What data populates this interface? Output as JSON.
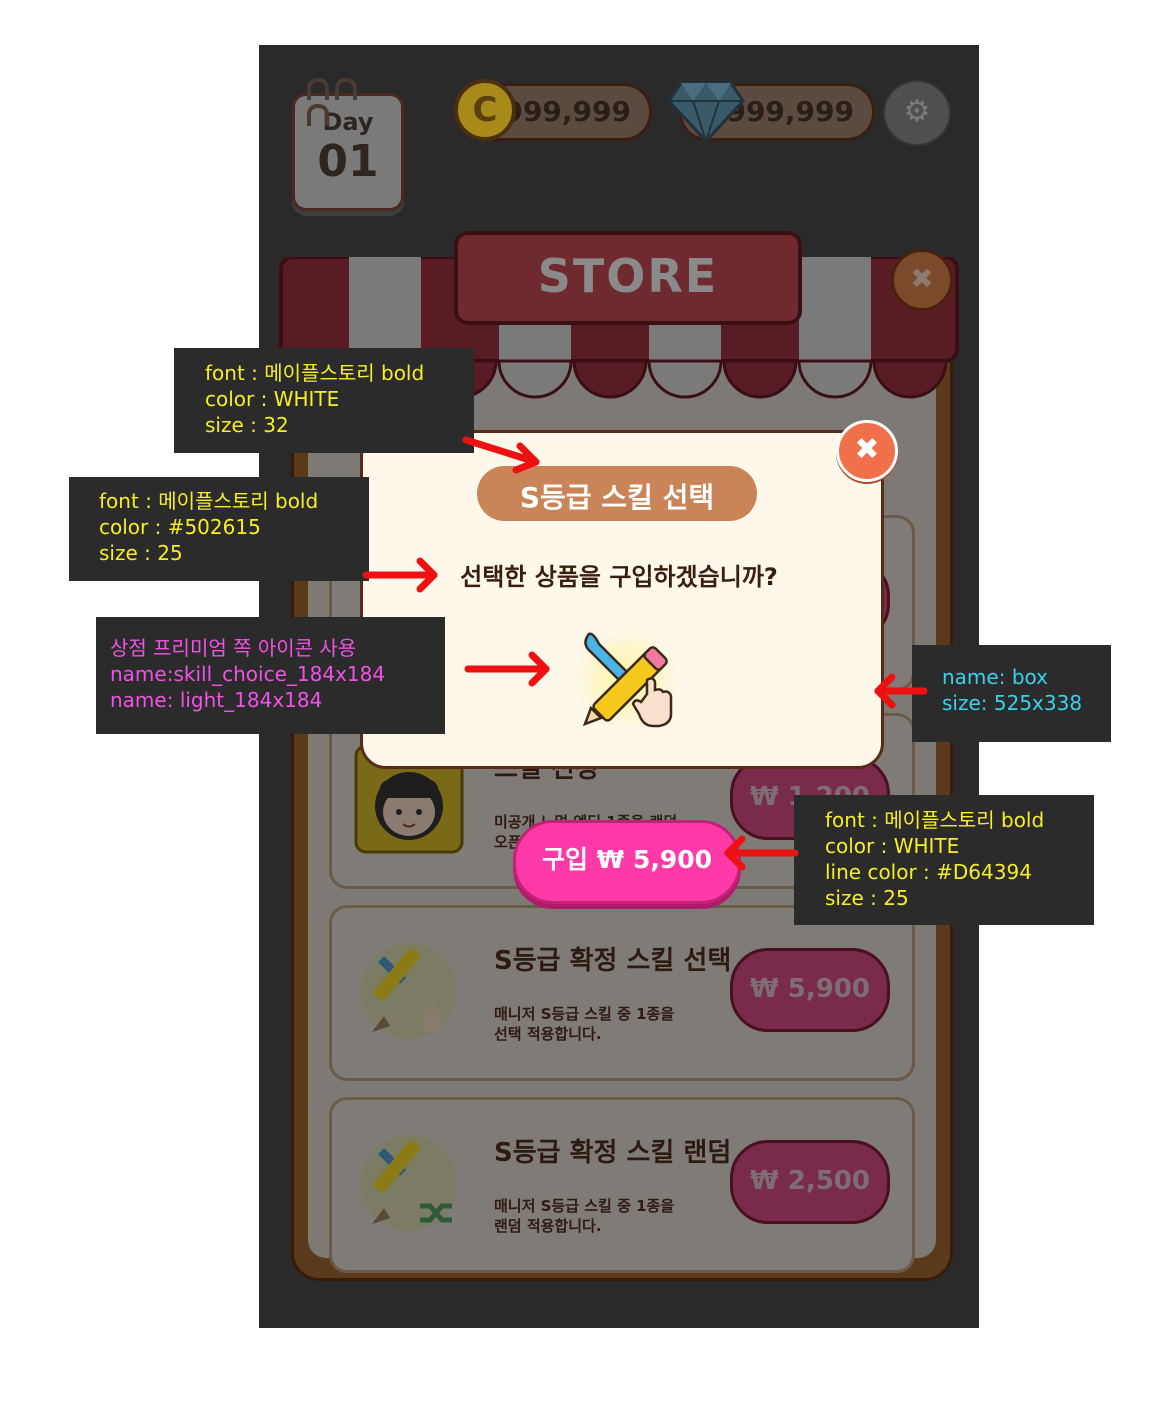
{
  "topbar": {
    "day_label": "Day",
    "day_number": "01",
    "coins": "999,999",
    "coin_symbol": "C",
    "gems": "999,999",
    "settings_icon": "gear-icon"
  },
  "store": {
    "title": "STORE",
    "close_icon": "close-icon",
    "items": [
      {
        "title": "",
        "desc_lines": [
          "",
          ""
        ],
        "price": ""
      },
      {
        "title": "스킬 선정",
        "desc_lines": [
          "미공개 노멀 엔딩 1종을 랜덤",
          "오픈"
        ],
        "price": "₩ 1,200"
      },
      {
        "title": "S등급 확정 스킬 선택",
        "desc_lines": [
          "매니저 S등급 스킬 중 1종을",
          "선택 적용합니다."
        ],
        "price": "₩ 5,900"
      },
      {
        "title": "S등급 확정 스킬 랜덤",
        "desc_lines": [
          "매니저 S등급 스킬 중 1종을",
          "랜덤 적용합니다."
        ],
        "price": "₩ 2,500"
      }
    ]
  },
  "popup": {
    "title": "S등급 스킬 선택",
    "question": "선택한 상품을 구입하겠습니까?",
    "close_icon": "close-icon",
    "icon": "skill-choice-icon",
    "buy_label": "구입  ₩ 5,900"
  },
  "annotations": {
    "title_spec": [
      "font : 메이플스토리 bold",
      "color : WHITE",
      "size : 32"
    ],
    "question_spec": [
      "font : 메이플스토리 bold",
      "color : #502615",
      "size : 25"
    ],
    "icon_spec": [
      "상점 프리미엄 쪽 아이콘 사용",
      "name:skill_choice_184x184",
      "name: light_184x184"
    ],
    "box_spec": [
      "name: box",
      "size: 525x338"
    ],
    "button_spec": [
      "font : 메이플스토리 bold",
      "color : WHITE",
      "line color : #D64394",
      "size : 25"
    ]
  },
  "colors": {
    "annotation_yellow": "#f5ee28",
    "annotation_magenta": "#f052e6",
    "annotation_cyan": "#38d2ec",
    "arrow_red": "#ee1111",
    "buy_button": "#ff3aa8",
    "popup_title_pill": "#c98558"
  }
}
